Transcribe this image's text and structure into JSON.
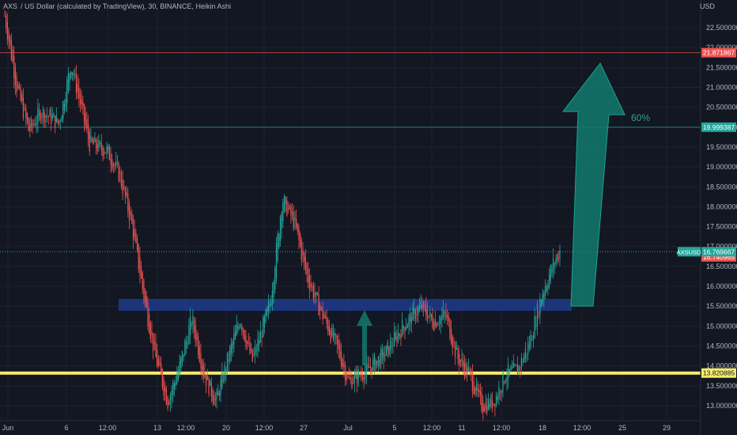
{
  "header": {
    "symbol": "AXS",
    "title": "/ US Dollar (calculated by TradingView), 30, BINANCE, Heikin Ashi"
  },
  "currency": "USD",
  "colors": {
    "background": "#131722",
    "up": "#26a69a",
    "down": "#ef5350",
    "support": "#f5ec6b",
    "zone": "#1e3a8a",
    "arrow": "#127a6e",
    "axis_text": "#b2b5be"
  },
  "price_labels": [
    {
      "value": "21.871867",
      "price": 21.871867,
      "color": "#ef5350",
      "line": true
    },
    {
      "value": "19.999387",
      "price": 19.999387,
      "color": "#26a69a",
      "line": true
    },
    {
      "value": "16.740965",
      "price": 16.740965,
      "color": "#ef5350",
      "line": false
    },
    {
      "value": "13.820885",
      "price": 13.820885,
      "color": "#f5ec6b",
      "line": true
    }
  ],
  "current": {
    "symbol_tag": "AXSUSD",
    "value": "16.769667",
    "price": 16.87
  },
  "annotations": {
    "target_label": "60%"
  },
  "chart_data": {
    "type": "candlestick",
    "style": "Heikin Ashi",
    "interval": "30",
    "exchange": "BINANCE",
    "ylim": [
      12.75,
      23.0
    ],
    "y_ticks": [
      "22.500000",
      "22.000000",
      "21.500000",
      "21.000000",
      "20.500000",
      "20.000000",
      "19.500000",
      "19.000000",
      "18.500000",
      "18.000000",
      "17.500000",
      "17.000000",
      "16.500000",
      "16.000000",
      "15.500000",
      "15.000000",
      "14.500000",
      "14.000000",
      "13.500000",
      "13.000000"
    ],
    "x_ticks": [
      "Jun",
      "6",
      "12:00",
      "13",
      "12:00",
      "20",
      "12:00",
      "27",
      "Jul",
      "5",
      "12:00",
      "11",
      "12:00",
      "18",
      "12:00",
      "25",
      "29"
    ],
    "trend": [
      {
        "t": 0,
        "p": 22.8
      },
      {
        "t": 0.02,
        "p": 21.0
      },
      {
        "t": 0.04,
        "p": 19.9
      },
      {
        "t": 0.06,
        "p": 20.4
      },
      {
        "t": 0.09,
        "p": 20.1
      },
      {
        "t": 0.11,
        "p": 21.6
      },
      {
        "t": 0.14,
        "p": 19.6
      },
      {
        "t": 0.17,
        "p": 19.4
      },
      {
        "t": 0.19,
        "p": 18.8
      },
      {
        "t": 0.21,
        "p": 17.6
      },
      {
        "t": 0.23,
        "p": 15.8
      },
      {
        "t": 0.25,
        "p": 14.2
      },
      {
        "t": 0.27,
        "p": 13.1
      },
      {
        "t": 0.29,
        "p": 14.0
      },
      {
        "t": 0.31,
        "p": 15.2
      },
      {
        "t": 0.33,
        "p": 13.8
      },
      {
        "t": 0.35,
        "p": 13.1
      },
      {
        "t": 0.37,
        "p": 14.2
      },
      {
        "t": 0.39,
        "p": 15.2
      },
      {
        "t": 0.41,
        "p": 14.1
      },
      {
        "t": 0.44,
        "p": 15.6
      },
      {
        "t": 0.46,
        "p": 18.2
      },
      {
        "t": 0.48,
        "p": 17.6
      },
      {
        "t": 0.5,
        "p": 16.3
      },
      {
        "t": 0.52,
        "p": 15.5
      },
      {
        "t": 0.55,
        "p": 14.5
      },
      {
        "t": 0.57,
        "p": 13.6
      },
      {
        "t": 0.6,
        "p": 13.9
      },
      {
        "t": 0.63,
        "p": 14.3
      },
      {
        "t": 0.66,
        "p": 15.0
      },
      {
        "t": 0.69,
        "p": 15.5
      },
      {
        "t": 0.71,
        "p": 15.1
      },
      {
        "t": 0.73,
        "p": 15.3
      },
      {
        "t": 0.75,
        "p": 14.2
      },
      {
        "t": 0.77,
        "p": 13.8
      },
      {
        "t": 0.79,
        "p": 13.0
      },
      {
        "t": 0.81,
        "p": 13.1
      },
      {
        "t": 0.83,
        "p": 13.8
      },
      {
        "t": 0.85,
        "p": 13.9
      },
      {
        "t": 0.87,
        "p": 14.6
      },
      {
        "t": 0.89,
        "p": 15.8
      },
      {
        "t": 0.91,
        "p": 16.6
      },
      {
        "t": 0.92,
        "p": 16.9
      }
    ]
  }
}
